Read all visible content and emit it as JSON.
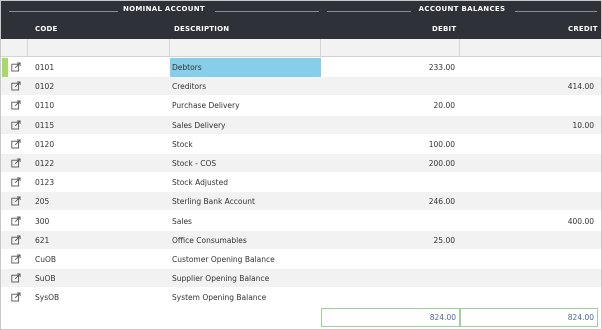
{
  "header": {
    "group_nominal": "NOMINAL ACCOUNT",
    "group_balances": "ACCOUNT BALANCES",
    "col_code": "CODE",
    "col_description": "DESCRIPTION",
    "col_debit": "DEBIT",
    "col_credit": "CREDIT"
  },
  "rows": [
    {
      "code": "0101",
      "description": "Debtors",
      "debit": "233.00",
      "credit": ""
    },
    {
      "code": "0102",
      "description": "Creditors",
      "debit": "",
      "credit": "414.00"
    },
    {
      "code": "0110",
      "description": "Purchase Delivery",
      "debit": "20.00",
      "credit": ""
    },
    {
      "code": "0115",
      "description": "Sales Delivery",
      "debit": "",
      "credit": "10.00"
    },
    {
      "code": "0120",
      "description": "Stock",
      "debit": "100.00",
      "credit": ""
    },
    {
      "code": "0122",
      "description": "Stock - COS",
      "debit": "200.00",
      "credit": ""
    },
    {
      "code": "0123",
      "description": "Stock Adjusted",
      "debit": "",
      "credit": ""
    },
    {
      "code": "205",
      "description": "Sterling Bank Account",
      "debit": "246.00",
      "credit": ""
    },
    {
      "code": "300",
      "description": "Sales",
      "debit": "",
      "credit": "400.00"
    },
    {
      "code": "621",
      "description": "Office Consumables",
      "debit": "25.00",
      "credit": ""
    },
    {
      "code": "CuOB",
      "description": "Customer Opening Balance",
      "debit": "",
      "credit": ""
    },
    {
      "code": "SuOB",
      "description": "Supplier Opening Balance",
      "debit": "",
      "credit": ""
    },
    {
      "code": "SysOB",
      "description": "System Opening Balance",
      "debit": "",
      "credit": ""
    }
  ],
  "totals": {
    "debit": "824.00",
    "credit": "824.00"
  },
  "selected_row": "0101",
  "icons": {
    "row_action": "edit-external-icon"
  },
  "colors": {
    "header_bg": "#2f3138",
    "selected_cell": "#87cfe9",
    "selected_marker": "#a6d96a",
    "totals_border": "#9fcf9a"
  }
}
